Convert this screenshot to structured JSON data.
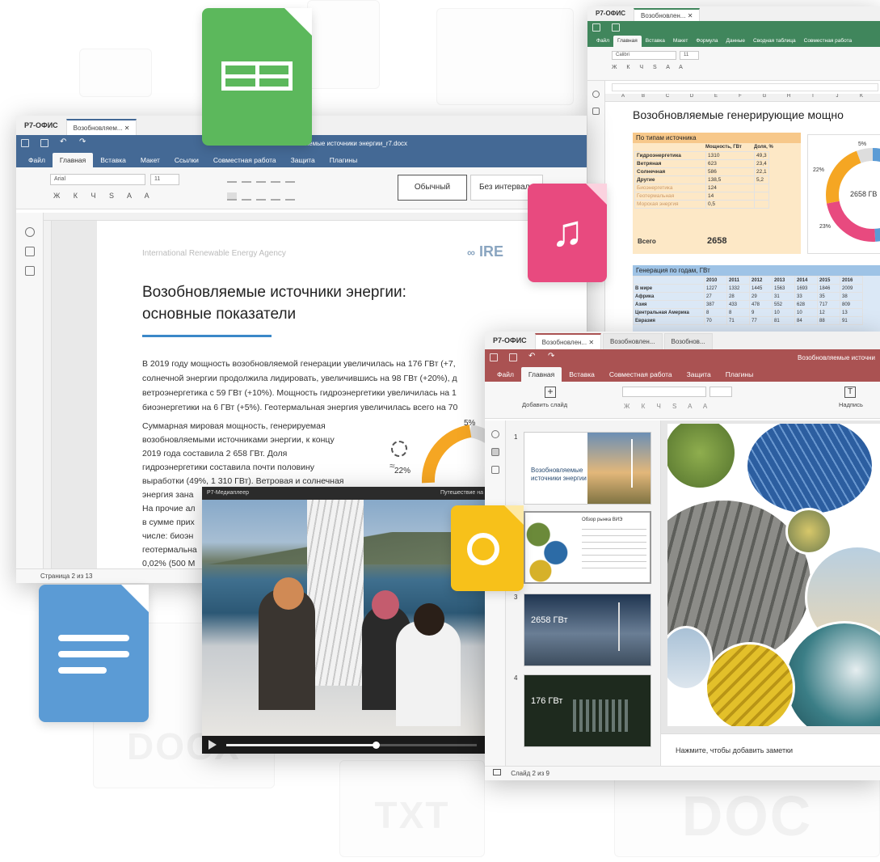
{
  "background_labels": [
    "DOCX",
    "TXT",
    "DOC"
  ],
  "writer": {
    "brand": "Р7-ОФИС",
    "tab": "Возобновляем...",
    "file_title": "Возобновляемые источники энергии_r7.docx",
    "menu": [
      "Файл",
      "Главная",
      "Вставка",
      "Макет",
      "Ссылки",
      "Совместная работа",
      "Защита",
      "Плагины"
    ],
    "font": "Arial",
    "font_size": "11",
    "style_normal": "Обычный",
    "style_nospacing": "Без интервала",
    "agency": "International Renewable Energy Agency",
    "logo_text": "IRE",
    "heading_line1": "Возобновляемые источники энергии:",
    "heading_line2": "основные показатели",
    "para1": [
      "В 2019 году мощность возобновляемой генерации увеличилась на 176 ГВт (+7,",
      "солнечной энергии продолжила лидировать, увеличившись на 98 ГВт (+20%), д",
      "ветроэнергетика с 59 ГВт (+10%). Мощность гидроэнергетики увеличилась на 1",
      "биоэнергетики на 6 ГВт (+5%). Геотермальная энергия увеличилась всего на 70"
    ],
    "para2": [
      "Суммарная мировая мощность, генерируемая",
      "возобновляемыми источниками энергии, к концу",
      "2019 года составила 2 658 ГВт.  Доля",
      "гидроэнергетики составила почти половину",
      "выработки (49%, 1 310 ГВт). Ветровая и солнечная",
      "энергия зана",
      "На прочие ал",
      "в сумме прих",
      "числе: биоэн",
      "геотермальна",
      "0,02% (500 М"
    ],
    "chart_pct_top": "5%",
    "chart_pct_side": "22%",
    "status": "Страница 2 из 13"
  },
  "spreadsheet": {
    "brand": "Р7-ОФИС",
    "tab": "Возобновлен...",
    "menu": [
      "Файл",
      "Главная",
      "Вставка",
      "Макет",
      "Формула",
      "Данные",
      "Сводная таблица",
      "Совместная работа"
    ],
    "font": "Calibri",
    "font_size": "11",
    "columns": [
      "A",
      "B",
      "C",
      "D",
      "E",
      "F",
      "G",
      "H",
      "I",
      "J",
      "K"
    ],
    "sheet_title": "Возобновляемые генерирующие мощно",
    "section1": "По типам источника",
    "col_headers": [
      "Мощность, ГВт",
      "Доля, %"
    ],
    "rows": [
      [
        "Гидроэнергетика",
        "1310",
        "49,3"
      ],
      [
        "Ветряная",
        "623",
        "23,4"
      ],
      [
        "Солнечная",
        "586",
        "22,1"
      ],
      [
        "Другие",
        "138,5",
        "5,2"
      ],
      [
        "Биоэнергетика",
        "124",
        ""
      ],
      [
        "Геотермальная",
        "14",
        ""
      ],
      [
        "Морская энергия",
        "0,5",
        ""
      ]
    ],
    "total_label": "Всего",
    "total_value": "2658",
    "section2": "Генерация по годам, ГВт",
    "years": [
      "2010",
      "2011",
      "2012",
      "2013",
      "2014",
      "2015",
      "2016"
    ],
    "year_rows": [
      [
        "В мире",
        "1227",
        "1332",
        "1445",
        "1563",
        "1693",
        "1846",
        "2009"
      ],
      [
        "Африка",
        "27",
        "28",
        "29",
        "31",
        "33",
        "35",
        "38"
      ],
      [
        "Азия",
        "387",
        "433",
        "478",
        "552",
        "628",
        "717",
        "809"
      ],
      [
        "Центральная Америка",
        "8",
        "8",
        "9",
        "10",
        "10",
        "12",
        "13"
      ],
      [
        "Евразия",
        "70",
        "71",
        "77",
        "81",
        "84",
        "88",
        "91"
      ]
    ],
    "donut_center": "2658 ГВ",
    "donut_pct_top": "5%",
    "donut_pct_left": "22%",
    "donut_pct_bottom": "23%"
  },
  "media": {
    "title": "Р7-Медиаплеер",
    "right_title": "Путешествие на",
    "progress": 0.6
  },
  "presentation": {
    "brand": "Р7-ОФИС",
    "tabs": [
      "Возобновлен...",
      "Возобновлен...",
      "Возобнов..."
    ],
    "file_title": "Возобновляемые источни",
    "menu": [
      "Файл",
      "Главная",
      "Вставка",
      "Совместная работа",
      "Защита",
      "Плагины"
    ],
    "add_slide": "Добавить слайд",
    "caption_btn": "Надпись",
    "slide_numbers": [
      "1",
      "2",
      "3",
      "4"
    ],
    "slide1_title": "Возобновляемые источники энергии",
    "slide2_title": "Обзор рынка ВИЭ",
    "slide3_title": "2658 ГВт",
    "slide4_title": "176 ГВт",
    "notes": "Нажмите, чтобы добавить заметки",
    "status": "Слайд 2 из 9"
  },
  "colors": {
    "writer": "#446995",
    "spreadsheet": "#40865c",
    "presentation": "#aa5252",
    "sheet_icon": "#5cb85c",
    "doc_icon": "#5b9bd5",
    "music_icon": "#e84a7f",
    "video_icon": "#f7c11a"
  }
}
